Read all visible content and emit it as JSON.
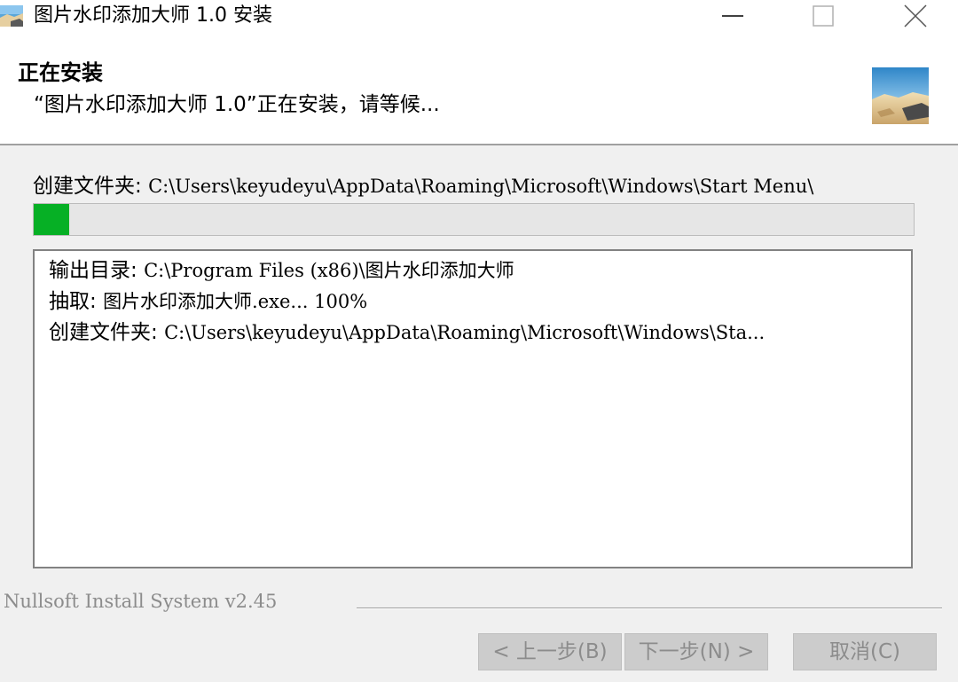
{
  "window": {
    "title": "图片水印添加大师 1.0 安装",
    "app_icon": "installer-app-icon"
  },
  "header": {
    "title": "正在安装",
    "subtitle": "“图片水印添加大师 1.0”正在安装，请等候...",
    "image": "installer-header-image"
  },
  "status": {
    "label": "创建文件夹:",
    "path": "C:\\Users\\keyudeyu\\AppData\\Roaming\\Microsoft\\Windows\\Start Menu\\"
  },
  "progress": {
    "value_percent": 4,
    "color": "#06b025"
  },
  "log": [
    {
      "label": "输出目录:",
      "text": "C:\\Program Files (x86)\\图片水印添加大师"
    },
    {
      "label": "抽取:",
      "text": "图片水印添加大师.exe... 100%"
    },
    {
      "label": "创建文件夹:",
      "text": "C:\\Users\\keyudeyu\\AppData\\Roaming\\Microsoft\\Windows\\Sta..."
    }
  ],
  "footer": {
    "brand": "Nullsoft Install System v2.45",
    "back_label": "< 上一步(B)",
    "next_label": "下一步(N) >",
    "cancel_label": "取消(C)"
  }
}
